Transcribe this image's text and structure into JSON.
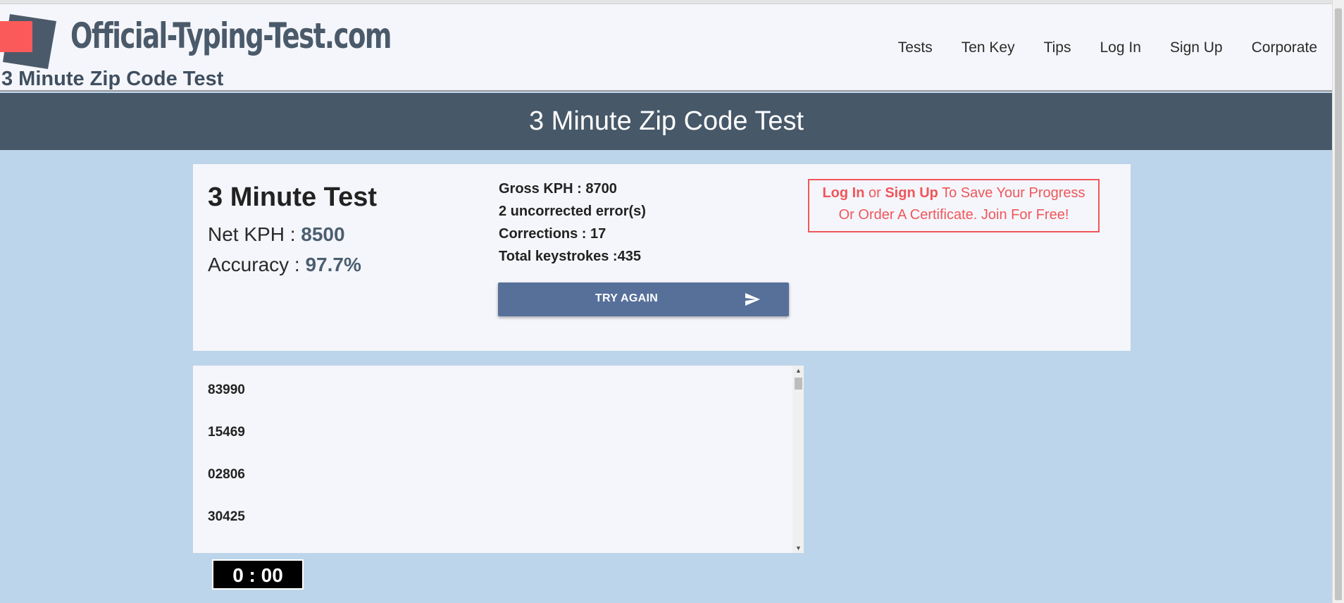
{
  "site": {
    "logo_text": "Official-Typing-Test.com",
    "subtitle": "3 Minute Zip Code Test",
    "colors": {
      "logo_red": "#fb5a5a",
      "logo_slate": "#4b5a6b"
    }
  },
  "nav": [
    "Tests",
    "Ten Key",
    "Tips",
    "Log In",
    "Sign Up",
    "Corporate"
  ],
  "banner": {
    "title": "3 Minute Zip Code Test",
    "color": "#475868"
  },
  "results": {
    "heading": "3 Minute Test",
    "net_kph_label": "Net KPH : ",
    "net_kph": "8500",
    "accuracy_label": "Accuracy : ",
    "accuracy": "97.7%",
    "gross_kph": "Gross KPH : 8700",
    "errors": "2 uncorrected error(s)",
    "corrections": "Corrections : 17",
    "keystrokes": "Total keystrokes :435",
    "try_again": "TRY AGAIN",
    "try_again_icon": "send-icon"
  },
  "cta": {
    "login": "Log In",
    "or": " or ",
    "signup": "Sign Up",
    "line1_rest": " To Save Your Progress",
    "line2": "Or Order A Certificate. Join For Free!",
    "color": "#f0565a"
  },
  "zip_codes": [
    "83990",
    "15469",
    "02806",
    "30425"
  ],
  "timer": "0 : 00"
}
